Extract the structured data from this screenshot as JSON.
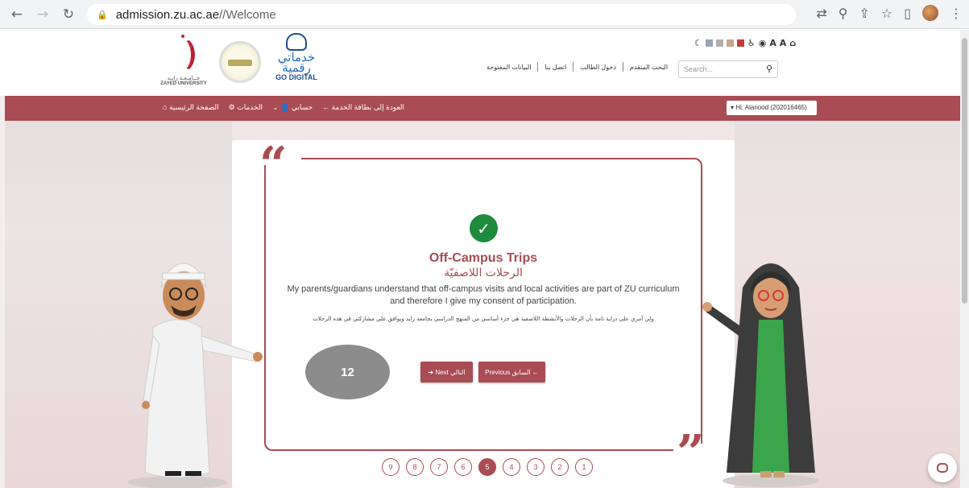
{
  "browser": {
    "url_host": "admission.zu.ac.ae",
    "url_path": "//Welcome"
  },
  "header": {
    "zu_logo": {
      "ar": "جــامـعـة زايـد",
      "en": "ZAYED UNIVERSITY"
    },
    "go_digital": {
      "ar": "خدماتي رقمية",
      "en": "GO DIGITAL"
    },
    "top_links": [
      "البحث المتقدم",
      "دخول الطالب",
      "اتصل بنا",
      "البيانات المفتوحة"
    ],
    "search_placeholder": "Search...",
    "a11y_text": "A A",
    "colors": [
      "#333333",
      "#9aa4b8",
      "#c9a78a",
      "#c23b3b"
    ]
  },
  "menu": {
    "items": [
      "الصفحة الرئيسية",
      "الخدمات",
      "حسابي",
      "العودة إلى بطاقة الخدمة"
    ],
    "user": "▾ Hi, Alanood (202016465)"
  },
  "content": {
    "title_en": "Off-Campus Trips",
    "title_ar": "الرحلات اللاصفيّة",
    "consent_en": "My parents/guardians understand that off-campus visits and local activities are part of ZU curriculum and therefore I give my consent of participation.",
    "consent_ar": "ولي أمري على دراية تامة بأن الرحلات والأنشطة اللاصفية هي جزء أساسي من المنهج الدراسي بجامعة زايد ويوافق على مشاركتي في هذه الرحلات",
    "badge": "12",
    "next_label": "Next التالي",
    "prev_label": "Previous السابق"
  },
  "pager": {
    "pages": [
      "9",
      "8",
      "7",
      "6",
      "5",
      "4",
      "3",
      "2",
      "1"
    ],
    "active": "5"
  },
  "theme": {
    "accent": "#a94c53",
    "success": "#1e8a3c"
  }
}
